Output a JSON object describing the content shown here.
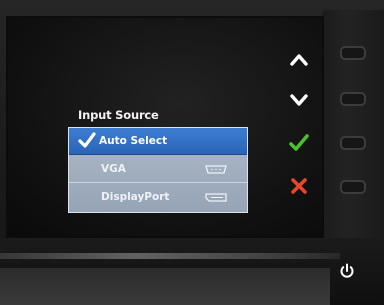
{
  "osd": {
    "menu_title": "Input Source",
    "options": [
      {
        "label": "Auto Select",
        "selected": true,
        "icon": "checkmark-icon"
      },
      {
        "label": "VGA",
        "selected": false,
        "icon": "vga-port-icon"
      },
      {
        "label": "DisplayPort",
        "selected": false,
        "icon": "displayport-icon"
      }
    ]
  },
  "controls": {
    "up": {
      "icon": "chevron-up-icon",
      "color": "#ffffff"
    },
    "down": {
      "icon": "chevron-down-icon",
      "color": "#ffffff"
    },
    "confirm": {
      "icon": "checkmark-icon",
      "color": "#4bbf2e"
    },
    "exit": {
      "icon": "close-icon",
      "color": "#e8462a"
    },
    "power": {
      "icon": "power-icon",
      "color": "#ffffff"
    }
  },
  "colors": {
    "selection": "#2f6fc4",
    "menu_background": "#a3aebe",
    "bezel": "#1c1c1c"
  }
}
